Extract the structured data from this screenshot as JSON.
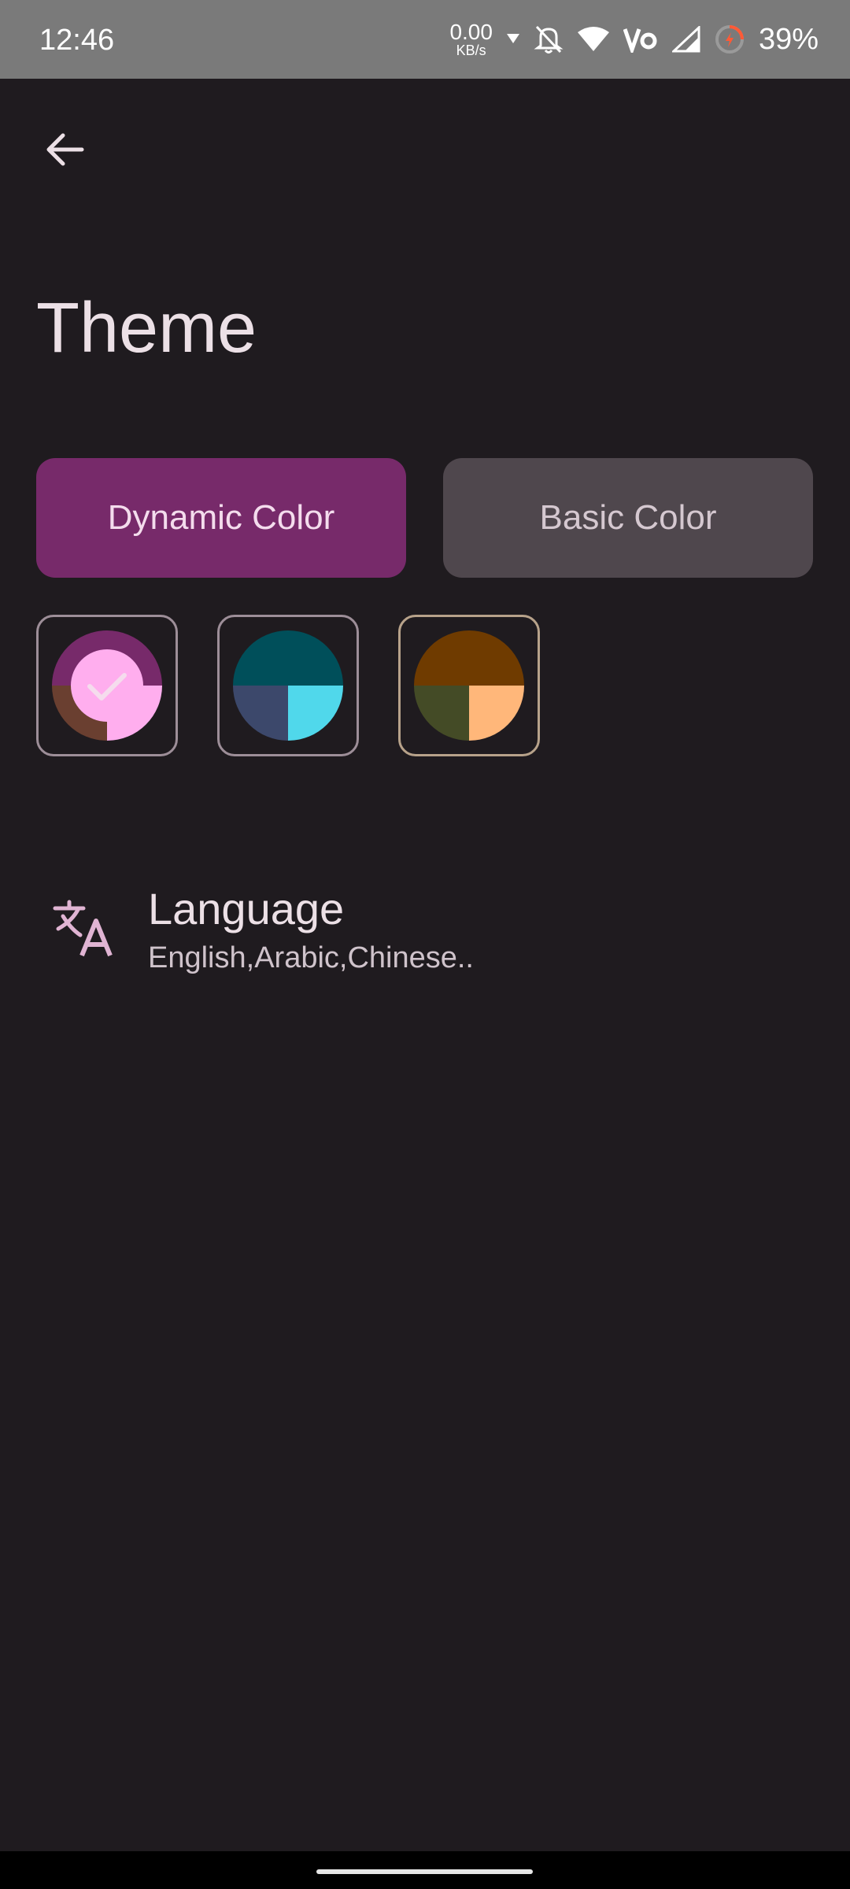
{
  "status_bar": {
    "time": "12:46",
    "net_speed_value": "0.00",
    "net_speed_unit": "KB/s",
    "battery_percent": "39%",
    "icons": [
      "download-arrow-icon",
      "bell-off-icon",
      "wifi-icon",
      "volte-icon",
      "signal-icon",
      "battery-saver-icon"
    ]
  },
  "header": {
    "back_icon": "arrow-left-icon"
  },
  "page": {
    "title": "Theme"
  },
  "theme_mode": {
    "options": [
      "Dynamic Color",
      "Basic Color"
    ],
    "selected": "Dynamic Color"
  },
  "palettes": [
    {
      "name_icon": "palette-swatch",
      "colors": [
        "#772a6a",
        "#6a3f30",
        "#ffaeee",
        "#ffaeee"
      ],
      "selected": true
    },
    {
      "name_icon": "palette-swatch",
      "colors": [
        "#004f5a",
        "#3c486b",
        "#50d8eb"
      ],
      "selected": false
    },
    {
      "name_icon": "palette-swatch",
      "colors": [
        "#6f3b00",
        "#444b26",
        "#ffb77a"
      ],
      "selected": false
    }
  ],
  "language": {
    "icon": "translate-icon",
    "title": "Language",
    "subtitle": "English,Arabic,Chinese.."
  },
  "colors": {
    "background": "#1f1b1f",
    "accent_selected": "#772a6a",
    "accent_unselected": "#4f474d"
  }
}
